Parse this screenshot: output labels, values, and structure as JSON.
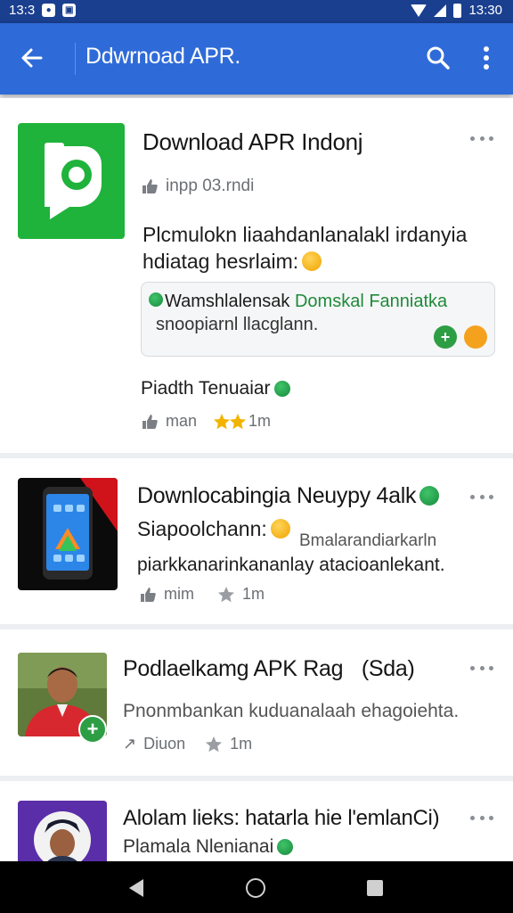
{
  "status_bar": {
    "time_left": "13:3",
    "time_right": "13:30"
  },
  "app_bar": {
    "title": "Ddwrnoad APR.",
    "back_icon": "arrow-left-icon",
    "search_icon": "search-icon",
    "menu_icon": "more-vert-icon"
  },
  "colors": {
    "app_bar": "#2f6bd8",
    "status_bar": "#1a3f8f",
    "accent_green": "#1fb33b",
    "star_gold": "#f2b400"
  },
  "items": [
    {
      "title": "Download APR Indonj",
      "subtitle": "inpp 03.rndi",
      "description_line1": "Plcmulokn liaahdanlanalakl irdanyia",
      "description_line2": "hdiatag hesrlaim:",
      "info_line1_prefix": "Wamshlalensak",
      "info_line1_highlight": "Domskal Fanniatka",
      "info_line2": "snoopiarnl llacglann.",
      "section_label": "Piadth Tenuaiar",
      "meta_label": "man",
      "rating": "1m"
    },
    {
      "title": "Downlocabingia Neuypy 4alk",
      "line1": "Siapoolchann:",
      "line1_right": "Bmalarandiarkarln",
      "line2": "piarkkanarinkananlay atacioanlekant.",
      "meta_label": "mim",
      "rating": "1m"
    },
    {
      "title": "Podlaelkamg APK Rag",
      "title_tag": "(Sda)",
      "line1": "Pnonmbankan kuduanalaah ehagoiehta.",
      "meta_label": "Diuon",
      "rating": "1m"
    },
    {
      "title": "Alolam lieks: hatarla hie l'emlanCi)",
      "line1": "Plamala Nlenianai"
    }
  ]
}
